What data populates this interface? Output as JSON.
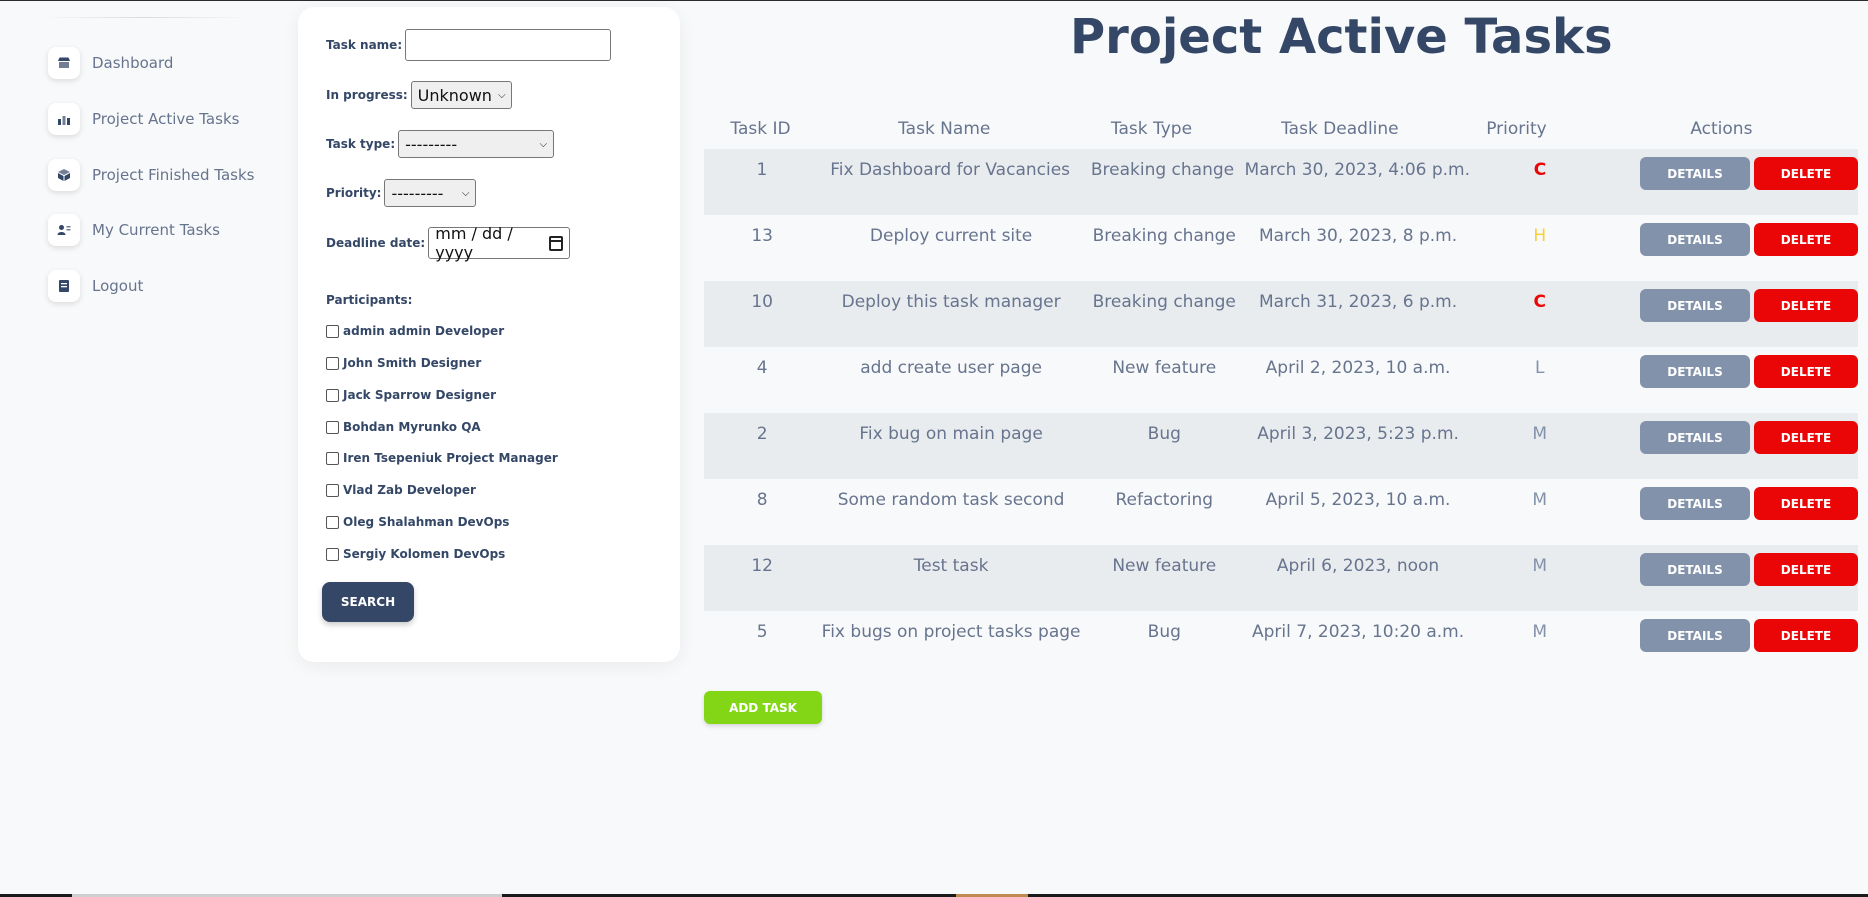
{
  "sidebar": {
    "items": [
      {
        "label": "Dashboard",
        "icon": "shop-icon"
      },
      {
        "label": "Project Active Tasks",
        "icon": "chart-icon"
      },
      {
        "label": "Project Finished Tasks",
        "icon": "box-icon"
      },
      {
        "label": "My Current Tasks",
        "icon": "user-icon"
      },
      {
        "label": "Logout",
        "icon": "document-icon"
      }
    ]
  },
  "filter": {
    "task_name_label": "Task name:",
    "task_name_value": "",
    "in_progress_label": "In progress:",
    "in_progress_value": "Unknown",
    "task_type_label": "Task type:",
    "task_type_value": "---------",
    "priority_label": "Priority:",
    "priority_value": "---------",
    "deadline_label": "Deadline date:",
    "deadline_placeholder": "mm / dd / yyyy",
    "participants_label": "Participants:",
    "participants": [
      "admin admin Developer",
      "John Smith Designer",
      "Jack Sparrow Designer",
      "Bohdan Myrunko QA",
      "Iren Tsepeniuk Project Manager",
      "Vlad Zab Developer",
      "Oleg Shalahman DevOps",
      "Sergiy Kolomen DevOps"
    ],
    "search_label": "SEARCH"
  },
  "main": {
    "title": "Project Active Tasks",
    "columns": [
      "Task ID",
      "Task Name",
      "Task Type",
      "Task Deadline",
      "Priority",
      "Actions"
    ],
    "rows": [
      {
        "id": "1",
        "name": "Fix Dashboard for Vacancies",
        "type": "Breaking change",
        "deadline": "March 30, 2023, 4:06 p.m.",
        "priority": "C"
      },
      {
        "id": "13",
        "name": "Deploy current site",
        "type": "Breaking change",
        "deadline": "March 30, 2023, 8 p.m.",
        "priority": "H"
      },
      {
        "id": "10",
        "name": "Deploy this task manager",
        "type": "Breaking change",
        "deadline": "March 31, 2023, 6 p.m.",
        "priority": "C"
      },
      {
        "id": "4",
        "name": "add create user page",
        "type": "New feature",
        "deadline": "April 2, 2023, 10 a.m.",
        "priority": "L"
      },
      {
        "id": "2",
        "name": "Fix bug on main page",
        "type": "Bug",
        "deadline": "April 3, 2023, 5:23 p.m.",
        "priority": "M"
      },
      {
        "id": "8",
        "name": "Some random task second",
        "type": "Refactoring",
        "deadline": "April 5, 2023, 10 a.m.",
        "priority": "M"
      },
      {
        "id": "12",
        "name": "Test task",
        "type": "New feature",
        "deadline": "April 6, 2023, noon",
        "priority": "M"
      },
      {
        "id": "5",
        "name": "Fix bugs on project tasks page",
        "type": "Bug",
        "deadline": "April 7, 2023, 10:20 a.m.",
        "priority": "M"
      }
    ],
    "details_label": "DETAILS",
    "delete_label": "DELETE",
    "add_task_label": "ADD TASK"
  },
  "colors": {
    "C": "#ea0606",
    "H": "#fbcf33",
    "L": "#8392ab",
    "M": "#8392ab"
  }
}
